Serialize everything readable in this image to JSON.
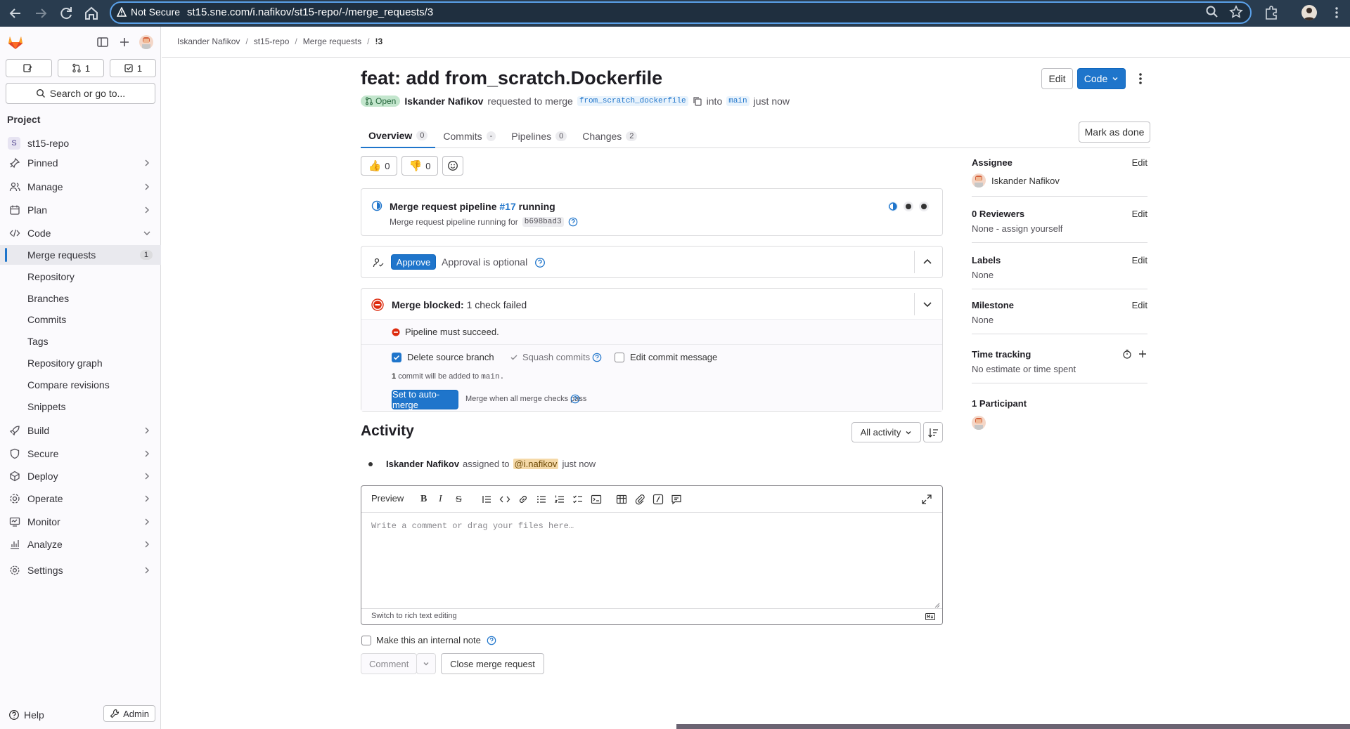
{
  "browser": {
    "security_label": "Not Secure",
    "url": "st15.sne.com/i.nafikov/st15-repo/-/merge_requests/3"
  },
  "sidebar": {
    "counts": {
      "issues": "",
      "merge_requests": "1",
      "todos": "1"
    },
    "search_label": "Search or go to...",
    "section_title": "Project",
    "project_initial": "S",
    "project_name": "st15-repo",
    "items": [
      {
        "label": "Pinned"
      },
      {
        "label": "Manage"
      },
      {
        "label": "Plan"
      },
      {
        "label": "Code"
      },
      {
        "label": "Merge requests",
        "badge": "1"
      },
      {
        "label": "Repository"
      },
      {
        "label": "Branches"
      },
      {
        "label": "Commits"
      },
      {
        "label": "Tags"
      },
      {
        "label": "Repository graph"
      },
      {
        "label": "Compare revisions"
      },
      {
        "label": "Snippets"
      },
      {
        "label": "Build"
      },
      {
        "label": "Secure"
      },
      {
        "label": "Deploy"
      },
      {
        "label": "Operate"
      },
      {
        "label": "Monitor"
      },
      {
        "label": "Analyze"
      },
      {
        "label": "Settings"
      }
    ],
    "help_label": "Help",
    "admin_label": "Admin"
  },
  "breadcrumbs": [
    "Iskander Nafikov",
    "st15-repo",
    "Merge requests",
    "!3"
  ],
  "mr": {
    "title": "feat: add from_scratch.Dockerfile",
    "edit_label": "Edit",
    "code_label": "Code",
    "status": "Open",
    "author": "Iskander Nafikov",
    "requested_text": "requested to merge",
    "source_branch": "from_scratch_dockerfile",
    "into_text": "into",
    "target_branch": "main",
    "time": "just now",
    "mark_done_label": "Mark as done"
  },
  "tabs": [
    {
      "label": "Overview",
      "count": "0"
    },
    {
      "label": "Commits",
      "count": "-"
    },
    {
      "label": "Pipelines",
      "count": "0"
    },
    {
      "label": "Changes",
      "count": "2"
    }
  ],
  "reactions": {
    "thumbs_up": "0",
    "thumbs_down": "0"
  },
  "pipeline": {
    "title_prefix": "Merge request pipeline",
    "id": "#17",
    "status": "running",
    "sub_prefix": "Merge request pipeline running for",
    "sha": "b698bad3"
  },
  "approval": {
    "button": "Approve",
    "text": "Approval is optional"
  },
  "merge": {
    "blocked_bold": "Merge blocked:",
    "blocked_text": "1 check failed",
    "check": "Pipeline must succeed.",
    "delete_source": "Delete source branch",
    "squash": "Squash commits",
    "edit_message": "Edit commit message",
    "commit_count": "1",
    "commit_text_a": "commit will be added to",
    "commit_branch": "main.",
    "auto_merge": "Set to auto-merge",
    "auto_merge_hint": "Merge when all merge checks pass"
  },
  "activity": {
    "title": "Activity",
    "filter": "All activity",
    "entry_author": "Iskander Nafikov",
    "entry_action": "assigned to",
    "entry_mention": "@i.nafikov",
    "entry_time": "just now"
  },
  "editor": {
    "preview_label": "Preview",
    "placeholder": "Write a comment or drag your files here…",
    "switch_label": "Switch to rich text editing",
    "internal_note": "Make this an internal note",
    "comment_label": "Comment",
    "close_label": "Close merge request"
  },
  "right": {
    "assignee_label": "Assignee",
    "assignee_name": "Iskander Nafikov",
    "reviewers_label": "0 Reviewers",
    "reviewers_value": "None - assign yourself",
    "labels_label": "Labels",
    "labels_value": "None",
    "milestone_label": "Milestone",
    "milestone_value": "None",
    "time_label": "Time tracking",
    "time_value": "No estimate or time spent",
    "participants_label": "1 Participant",
    "edit": "Edit"
  }
}
